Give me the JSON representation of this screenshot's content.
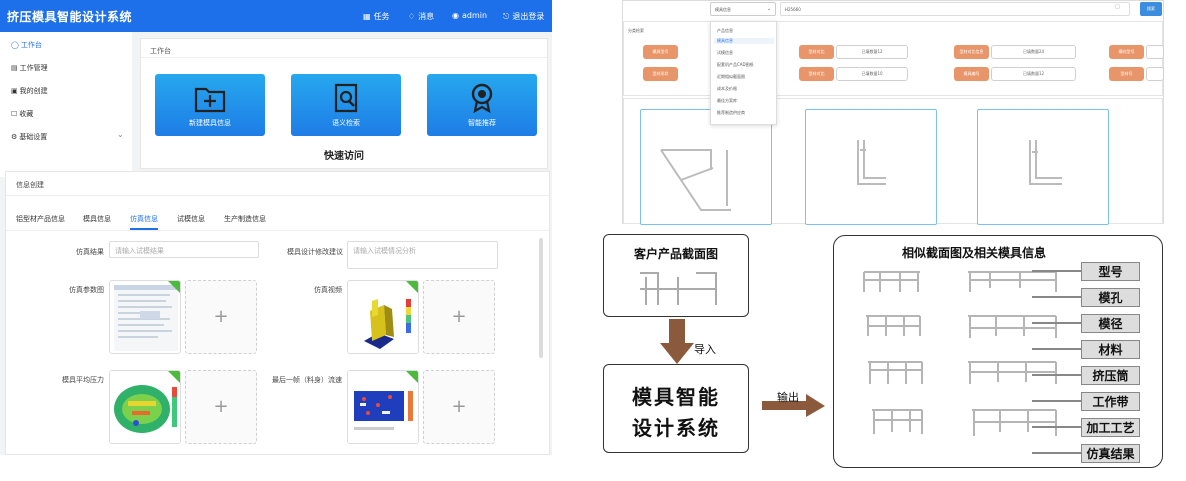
{
  "app": {
    "title": "挤压模具智能设计系统"
  },
  "topnav": [
    {
      "label": "任务",
      "icon": "task-icon"
    },
    {
      "label": "消息",
      "icon": "bell-icon"
    },
    {
      "label": "admin",
      "icon": "user-icon"
    },
    {
      "label": "退出登录",
      "icon": "logout-icon"
    }
  ],
  "sidebar": {
    "items": [
      {
        "label": "工作台",
        "icon": "home-icon",
        "active": true
      },
      {
        "label": "工作管理",
        "icon": "briefcase-icon"
      },
      {
        "label": "我的创建",
        "icon": "edit-icon"
      },
      {
        "label": "收藏",
        "icon": "star-icon"
      },
      {
        "label": "基础设置",
        "icon": "settings-icon",
        "has_submenu": true
      }
    ]
  },
  "workbench": {
    "header": "工作台",
    "quick_access_title": "快速访问",
    "tiles": [
      {
        "label": "新建模具信息",
        "icon": "folder-plus-icon"
      },
      {
        "label": "语义检索",
        "icon": "document-search-icon"
      },
      {
        "label": "智能推荐",
        "icon": "award-icon"
      }
    ]
  },
  "info_form": {
    "header": "信息创建",
    "tabs": [
      {
        "label": "铝型材产品信息"
      },
      {
        "label": "模具信息"
      },
      {
        "label": "仿真信息",
        "active": true
      },
      {
        "label": "试模信息"
      },
      {
        "label": "生产制造信息"
      }
    ],
    "fields": {
      "sim_result": {
        "label": "仿真结果",
        "placeholder": "请输入试模结果"
      },
      "design_suggest": {
        "label": "模具设计修改建议",
        "placeholder": "请输入试模情况分析"
      },
      "sim_params": {
        "label": "仿真参数图"
      },
      "sim_video": {
        "label": "仿真视频"
      },
      "avg_pressure": {
        "label": "模具平均压力"
      },
      "last_frame": {
        "label": "最后一帧（料身）流速"
      }
    },
    "upload_plus": "+"
  },
  "search_ui": {
    "select_value": "模具信息",
    "query": "H25660",
    "search_button": "搜索",
    "section_label": "分类检索",
    "dropdown_items": [
      "产品信息",
      "模具信息",
      "试模信息",
      "配套机产品CAD图纸",
      "近期相似截面图",
      "成本及价格",
      "最佳方案库",
      "推荐制造供应商"
    ],
    "left_chips": [
      {
        "label": "模具型号",
        "hint": ""
      },
      {
        "label": "型材形状",
        "hint": ""
      }
    ],
    "rows": [
      [
        {
          "label": "型材对比",
          "hint": "已填数量12"
        },
        {
          "label": "型材对比信息",
          "hint": "已填数量24"
        },
        {
          "label": "横向型号",
          "hint": ""
        }
      ],
      [
        {
          "label": "型材对比",
          "hint": "已填数量10"
        },
        {
          "label": "模具编号",
          "hint": "已填数量12"
        },
        {
          "label": "型材号",
          "hint": ""
        }
      ]
    ]
  },
  "flow": {
    "customer_box": "客户产品截面图",
    "import_label": "导入",
    "system_box": [
      "模具智能",
      "设计系统"
    ],
    "output_label": "输出",
    "similar_title": "相似截面图及相关模具信息",
    "tags": [
      "型号",
      "模孔",
      "模径",
      "材料",
      "挤压筒",
      "工作带",
      "加工工艺",
      "仿真结果"
    ]
  }
}
